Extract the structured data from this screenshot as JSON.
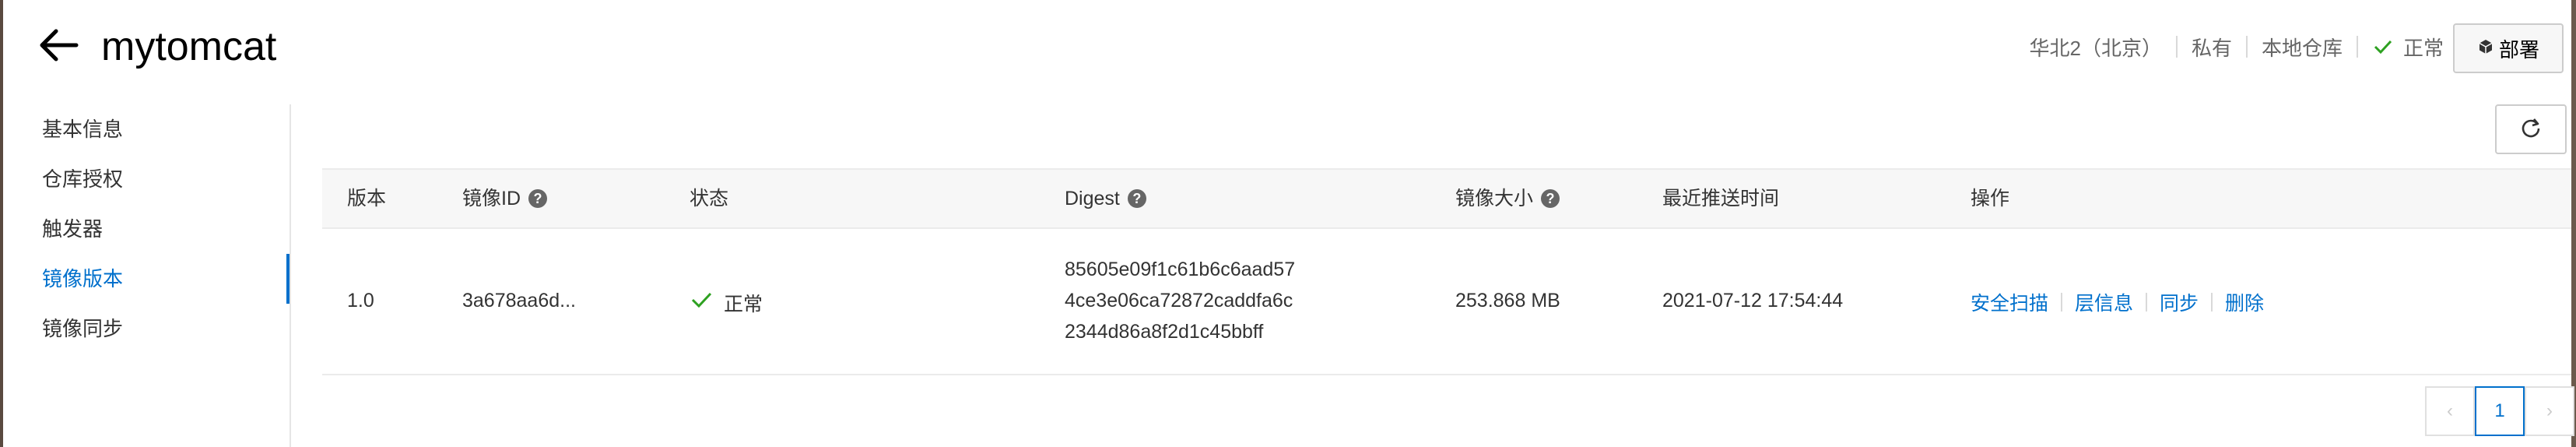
{
  "header": {
    "title": "mytomcat",
    "region": "华北2（北京）",
    "visibility": "私有",
    "repo_type": "本地仓库",
    "status": "正常",
    "deploy_button": "部署"
  },
  "sidebar": {
    "items": [
      {
        "label": "基本信息",
        "active": false
      },
      {
        "label": "仓库授权",
        "active": false
      },
      {
        "label": "触发器",
        "active": false
      },
      {
        "label": "镜像版本",
        "active": true
      },
      {
        "label": "镜像同步",
        "active": false
      }
    ]
  },
  "table": {
    "columns": {
      "version": "版本",
      "image_id": "镜像ID",
      "status": "状态",
      "digest": "Digest",
      "size": "镜像大小",
      "pushed": "最近推送时间",
      "actions": "操作"
    },
    "rows": [
      {
        "version": "1.0",
        "image_id": "3a678aa6d...",
        "status": "正常",
        "digest": [
          "85605e09f1c61b6c6aad57",
          "4ce3e06ca72872caddfa6c",
          "2344d86a8f2d1c45bbff"
        ],
        "size": "253.868 MB",
        "pushed": "2021-07-12 17:54:44",
        "actions": [
          "安全扫描",
          "层信息",
          "同步",
          "删除"
        ]
      }
    ]
  },
  "pagination": {
    "current_page": "1",
    "prev": "‹",
    "next": "›"
  },
  "colors": {
    "accent": "#0070cc",
    "success": "#2ea121"
  }
}
